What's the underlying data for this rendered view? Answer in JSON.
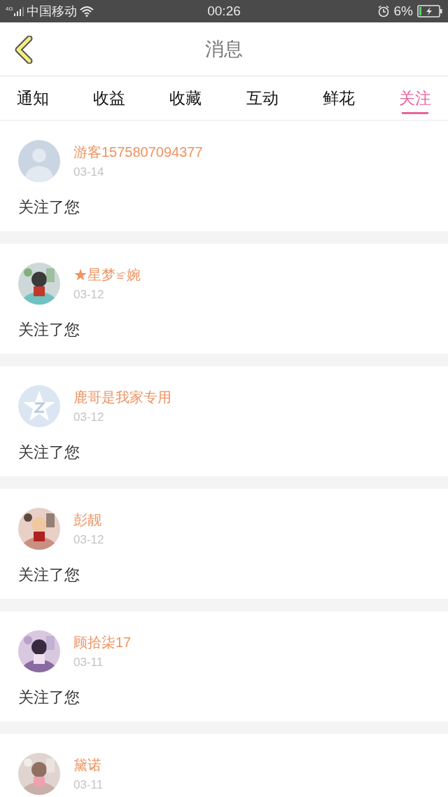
{
  "status_bar": {
    "network": "4G",
    "carrier": "中国移动",
    "time": "00:26",
    "battery": "6%"
  },
  "header": {
    "title": "消息"
  },
  "tabs": [
    {
      "label": "通知",
      "selected": false
    },
    {
      "label": "收益",
      "selected": false
    },
    {
      "label": "收藏",
      "selected": false
    },
    {
      "label": "互动",
      "selected": false
    },
    {
      "label": "鲜花",
      "selected": false
    },
    {
      "label": "关注",
      "selected": true
    }
  ],
  "messages": [
    {
      "avatar": {
        "kind": "default"
      },
      "name": "游客1575807094377",
      "date": "03-14",
      "text": "关注了您"
    },
    {
      "name": "★星梦≌婉",
      "date": "03-12",
      "text": "关注了您"
    },
    {
      "avatar": {
        "kind": "star"
      },
      "name": "鹿哥是我家专用",
      "date": "03-12",
      "text": "关注了您"
    },
    {
      "name": "彭靓",
      "date": "03-12",
      "text": "关注了您"
    },
    {
      "name": "顾拾柒17",
      "date": "03-11",
      "text": "关注了您"
    },
    {
      "name": "黛诺",
      "date": "03-11"
    }
  ]
}
